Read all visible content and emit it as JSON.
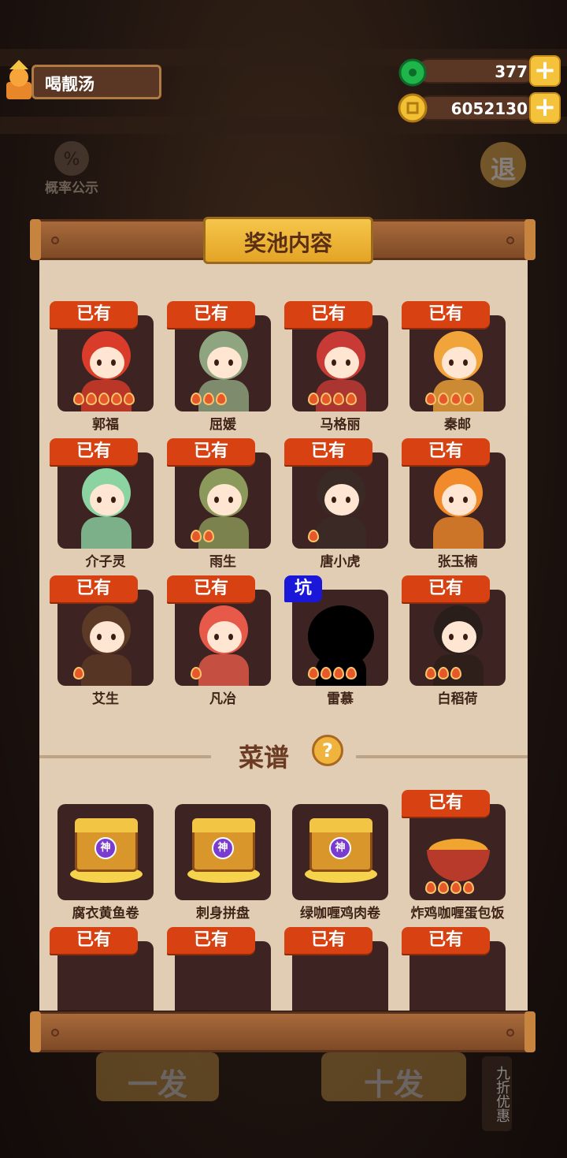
{
  "player": {
    "name": "喝靓汤"
  },
  "currency": {
    "jade": "377",
    "coins": "6052130"
  },
  "background": {
    "prob_label": "概率公示",
    "exit_label": "退",
    "single_draw": "一发",
    "ten_draw": "十发",
    "discount": "九折优惠"
  },
  "dialog": {
    "title": "奖池内容",
    "section_recipes": "菜谱",
    "help_icon": "?",
    "owned_label": "已有",
    "pit_label": "坑"
  },
  "characters": [
    {
      "name": "郭福",
      "badge": "已有",
      "flames": 5,
      "color": "#d93c2a"
    },
    {
      "name": "屈媛",
      "badge": "已有",
      "flames": 3,
      "color": "#8ea57f"
    },
    {
      "name": "马格丽",
      "badge": "已有",
      "flames": 4,
      "color": "#c73a35"
    },
    {
      "name": "秦邮",
      "badge": "已有",
      "flames": 4,
      "color": "#f1a43a"
    },
    {
      "name": "介子灵",
      "badge": "已有",
      "flames": 0,
      "color": "#8cd3a2"
    },
    {
      "name": "雨生",
      "badge": "已有",
      "flames": 2,
      "color": "#8b9a5a"
    },
    {
      "name": "唐小虎",
      "badge": "已有",
      "flames": 1,
      "color": "#3a2a26"
    },
    {
      "name": "张玉楠",
      "badge": "已有",
      "flames": 0,
      "color": "#f08a2a"
    },
    {
      "name": "艾生",
      "badge": "已有",
      "flames": 1,
      "color": "#5c3a26"
    },
    {
      "name": "凡冶",
      "badge": "已有",
      "flames": 1,
      "color": "#e75a4a"
    },
    {
      "name": "雷慕",
      "badge": "坑",
      "flames": 4,
      "color": "#000000"
    },
    {
      "name": "白稻荷",
      "badge": "已有",
      "flames": 3,
      "color": "#2a1e1a"
    }
  ],
  "recipes": [
    {
      "name": "腐衣黄鱼卷",
      "badge": "",
      "type": "chest",
      "seal": "神"
    },
    {
      "name": "刺身拼盘",
      "badge": "",
      "type": "chest",
      "seal": "神"
    },
    {
      "name": "绿咖喱鸡肉卷",
      "badge": "",
      "type": "chest",
      "seal": "神"
    },
    {
      "name": "炸鸡咖喱蛋包饭",
      "badge": "已有",
      "type": "dish",
      "flames": 4
    },
    {
      "name": "",
      "badge": "已有",
      "type": "partial"
    },
    {
      "name": "",
      "badge": "已有",
      "type": "partial"
    },
    {
      "name": "",
      "badge": "已有",
      "type": "partial"
    },
    {
      "name": "",
      "badge": "已有",
      "type": "partial"
    }
  ],
  "colors": {
    "badge_owned": "#d84112",
    "badge_pit": "#1a17d8",
    "paper": "#e1cdb3",
    "card_bg": "#3d2422"
  }
}
